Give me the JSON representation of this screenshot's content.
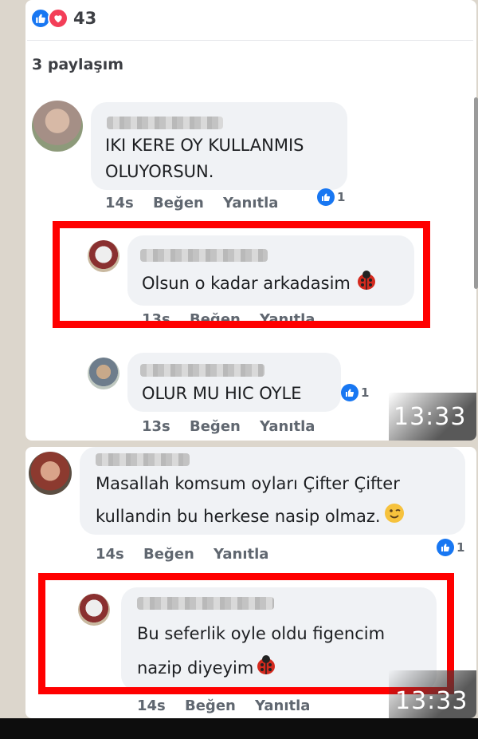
{
  "post": {
    "reaction_count": "43",
    "shares_label": "3 paylaşım"
  },
  "comments": [
    {
      "text_lines": [
        "IKI KERE OY KULLANMIS",
        "OLUYORSUN."
      ],
      "time": "14s",
      "like_label": "Beğen",
      "reply_label": "Yanıtla",
      "likes": "1"
    },
    {
      "text_lines": [
        "Olsun o kadar arkadasim"
      ],
      "time": "13s",
      "like_label": "Beğen",
      "reply_label": "Yanıtla"
    },
    {
      "text_lines": [
        "OLUR MU HIC OYLE"
      ],
      "time": "13s",
      "like_label": "Beğen",
      "reply_label": "Yanıtla",
      "likes": "1"
    },
    {
      "text_lines": [
        "Masallah komsum oyları Çifter Çifter",
        "kullandin bu herkese nasip olmaz."
      ],
      "time": "14s",
      "like_label": "Beğen",
      "reply_label": "Yanıtla",
      "likes": "1"
    },
    {
      "text_lines": [
        "Bu seferlik oyle oldu figencim",
        "nazip diyeyim"
      ],
      "time": "14s",
      "like_label": "Beğen",
      "reply_label": "Yanıtla"
    }
  ],
  "timestamps": [
    "13:33",
    "13:33"
  ],
  "colors": {
    "highlight": "#ff0000",
    "like_blue": "#1877f2",
    "love_red": "#f33e58"
  }
}
